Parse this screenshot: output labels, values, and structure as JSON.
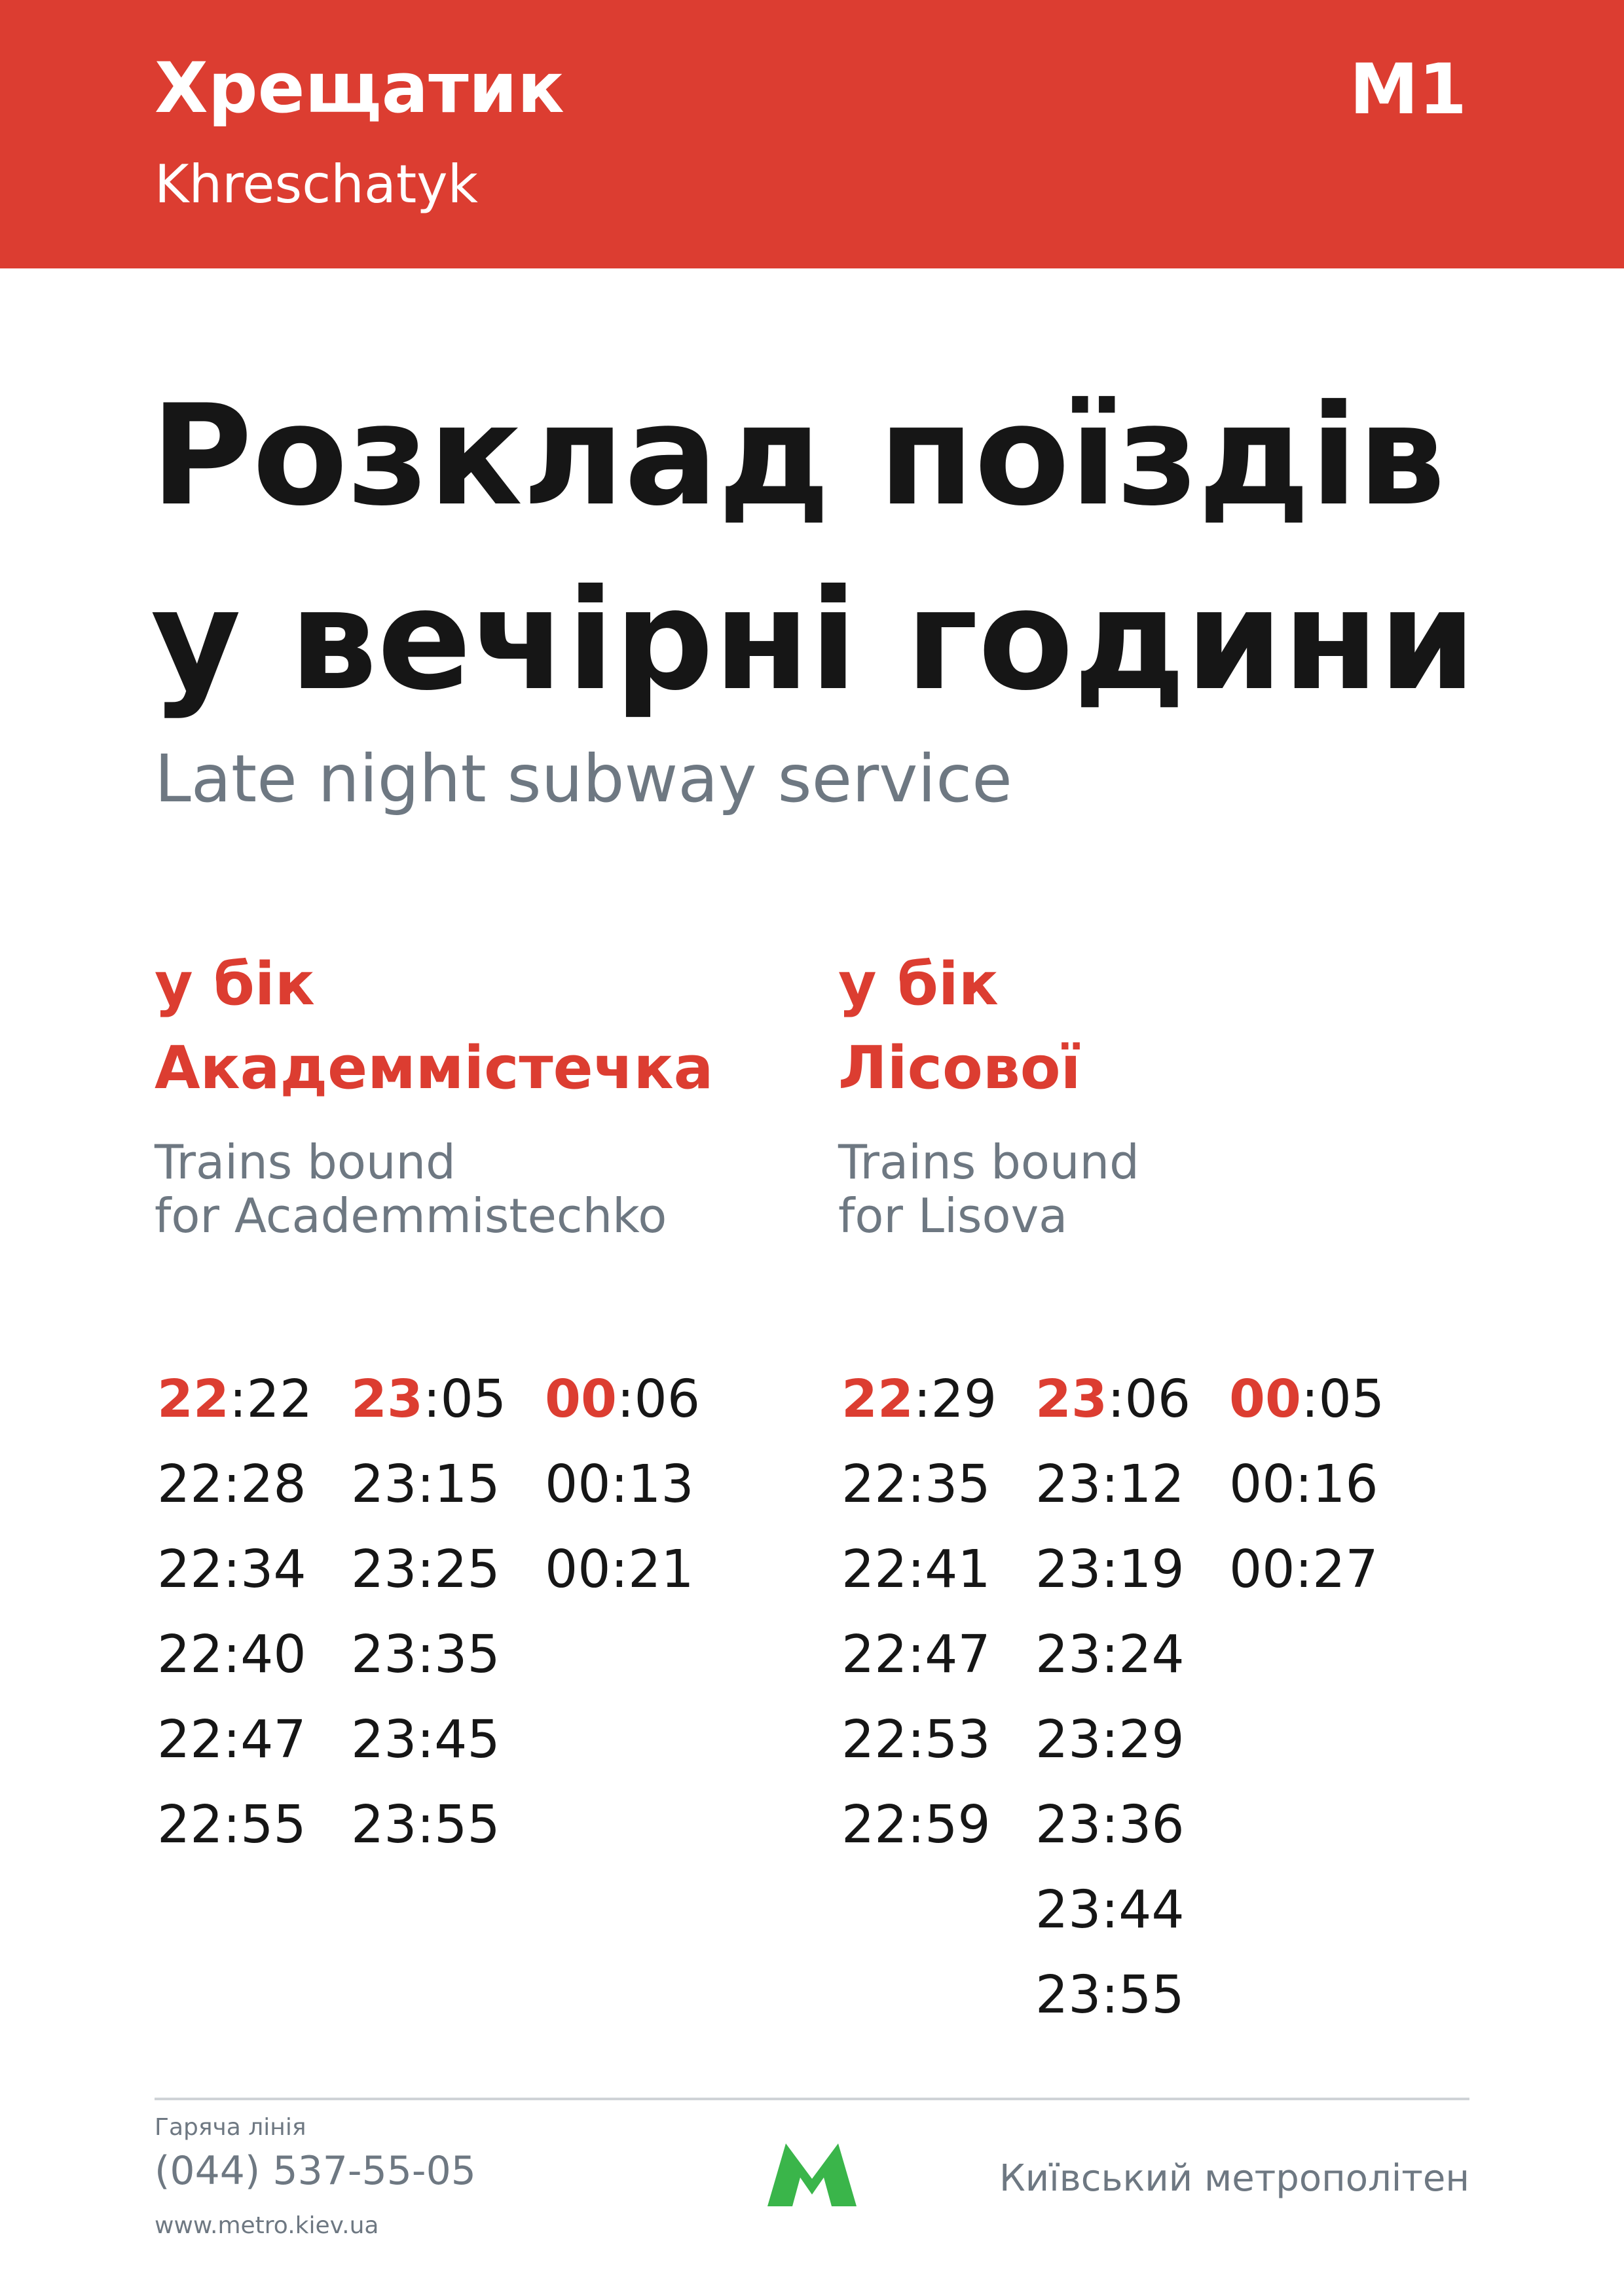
{
  "colors": {
    "header_red": "#dc3d31",
    "muted_gray": "#6e7882",
    "logo_green": "#3ab54a"
  },
  "header": {
    "station_ua": "Хрещатик",
    "station_en": "Khreschatyk",
    "line": "M1"
  },
  "title": {
    "line1": "Розклад поїздів",
    "line2": "у вечірні години",
    "subtitle": "Late night subway service"
  },
  "directions": [
    {
      "head_line1": "у бік",
      "head_line2": "Академмістечка",
      "en_line1": "Trains bound",
      "en_line2": "for Academmistechko",
      "columns": [
        [
          "22:22",
          "22:28",
          "22:34",
          "22:40",
          "22:47",
          "22:55"
        ],
        [
          "23:05",
          "23:15",
          "23:25",
          "23:35",
          "23:45",
          "23:55"
        ],
        [
          "00:06",
          "00:13",
          "00:21"
        ]
      ]
    },
    {
      "head_line1": "у бік",
      "head_line2": "Лісової",
      "en_line1": "Trains bound",
      "en_line2": "for Lisova",
      "columns": [
        [
          "22:29",
          "22:35",
          "22:41",
          "22:47",
          "22:53",
          "22:59"
        ],
        [
          "23:06",
          "23:12",
          "23:19",
          "23:24",
          "23:29",
          "23:36",
          "23:44",
          "23:55"
        ],
        [
          "00:05",
          "00:16",
          "00:27"
        ]
      ]
    }
  ],
  "footer": {
    "hotline_label": "Гаряча лінія",
    "hotline_phone": "(044) 537-55-05",
    "website": "www.metro.kiev.ua",
    "logo_icon": "kyiv-metro-m-logo-icon",
    "org_name": "Київський метрополітен"
  }
}
